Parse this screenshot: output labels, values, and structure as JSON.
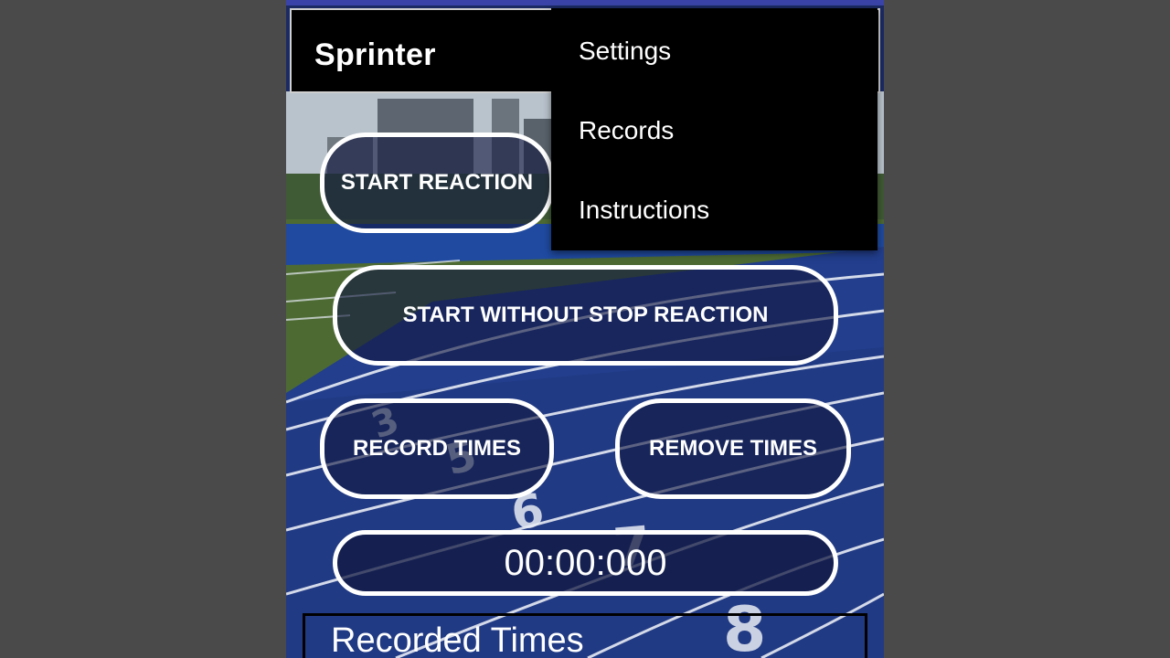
{
  "app": {
    "title": "Sprinter"
  },
  "menu": {
    "items": [
      {
        "label": "Settings"
      },
      {
        "label": "Records"
      },
      {
        "label": "Instructions"
      }
    ]
  },
  "buttons": {
    "start_reaction": "START REACTION",
    "start_without_stop": "START WITHOUT STOP REACTION",
    "record_times": "RECORD TIMES",
    "remove_times": "REMOVE TIMES"
  },
  "timer": {
    "value": "00:00:000"
  },
  "records": {
    "title": "Recorded Times"
  },
  "background": {
    "description_icon": "running-track-photo"
  },
  "colors": {
    "app_bar": "#000000",
    "button_border": "#ffffff",
    "track_blue": "#233a86"
  }
}
